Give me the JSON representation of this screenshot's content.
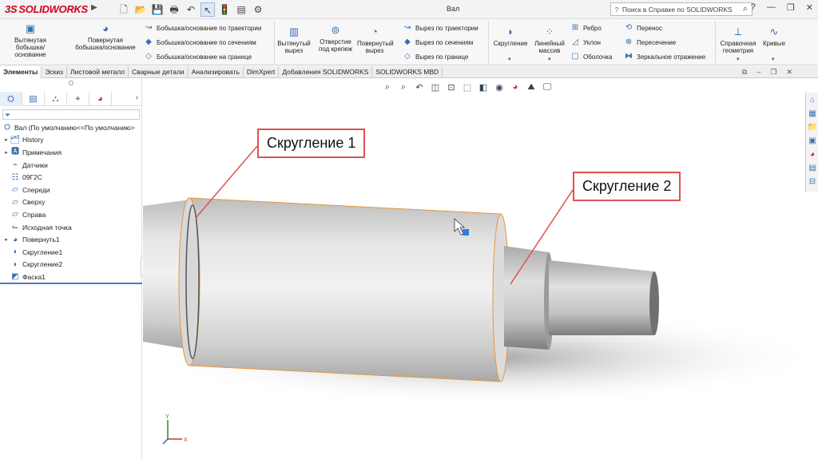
{
  "app": {
    "logo_prefix": "3S",
    "logo_name": "SOLIDWORKS",
    "title": "Вал"
  },
  "quick_access": {
    "icons": [
      "new-icon",
      "open-icon",
      "save-icon",
      "print-icon",
      "undo-icon",
      "select-icon",
      "rebuild-icon",
      "options-icon",
      "settings-icon"
    ]
  },
  "help": {
    "placeholder": "Поиск в Справке по SOLIDWORKS"
  },
  "window_controls": {
    "help": "?",
    "minimize": "—",
    "restore": "❐",
    "close": "✕"
  },
  "ribbon": {
    "extruded_boss": "Вытянутая бобышка/основание",
    "revolved_boss": "Повернутая бобышка/основание",
    "swept_boss": "Бобышка/основание по траектории",
    "lofted_boss": "Бобышка/основание по сечениям",
    "boundary_boss": "Бобышка/основание на границе",
    "extruded_cut": "Вытянутый вырез",
    "hole_wizard": "Отверстие под крепеж",
    "revolved_cut": "Повернутый вырез",
    "swept_cut": "Вырез по траектории",
    "lofted_cut": "Вырез по сечениям",
    "boundary_cut": "Вырез по границе",
    "fillet": "Скругление",
    "linear_pattern": "Линейный массив",
    "rib": "Ребро",
    "draft": "Уклон",
    "shell": "Оболочка",
    "wrap": "Перенос",
    "intersect": "Пересечение",
    "mirror": "Зеркальное отражение",
    "ref_geometry": "Справочная геометрия",
    "curves": "Кривые"
  },
  "tabs": [
    "Элементы",
    "Эскиз",
    "Листовой металл",
    "Сварные детали",
    "Анализировать",
    "DimXpert",
    "Добавления SOLIDWORKS",
    "SOLIDWORKS MBD"
  ],
  "tree": {
    "root": "Вал  (По умолчанию<<По умолчанию>",
    "items": [
      "History",
      "Примечания",
      "Датчики",
      "09Г2С",
      "Спереди",
      "Сверху",
      "Справа",
      "Исходная точка",
      "Повернуть1",
      "Скругление1",
      "Скругление2",
      "Фаска1"
    ]
  },
  "callouts": {
    "fillet1": "Скругление 1",
    "fillet2": "Скругление 2"
  },
  "triad": {
    "x": "X",
    "y": "Y"
  },
  "colors": {
    "accent": "#d0021b",
    "callout_border": "#e05050",
    "selection_edge": "#e8963c"
  }
}
